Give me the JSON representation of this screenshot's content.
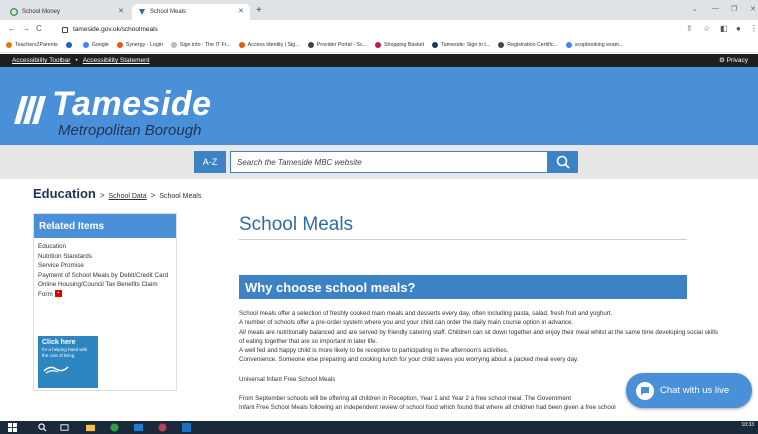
{
  "browser": {
    "tabs": [
      {
        "label": "School Money",
        "active": false
      },
      {
        "label": "School Meals",
        "active": true
      }
    ],
    "url": "tameside.gov.uk/schoolmeals",
    "bookmarks": [
      "Teachers2Parents",
      "Google",
      "Synergy - Login",
      "Sign into : The IT Fr...",
      "Access Identity | Sig...",
      "Provider Portal - Sc...",
      "Shopping Basket",
      "Tameside: Sign in t...",
      "Registration Certific...",
      "scopbooking exam..."
    ]
  },
  "accessibility": {
    "toolbar": "Accessibility Toolbar",
    "statement": "Accessibility Statement",
    "privacy": "Privacy"
  },
  "header": {
    "brand": "Tameside",
    "sub": "Metropolitan Borough"
  },
  "search": {
    "az": "A-Z",
    "placeholder": "Search the Tameside MBC website"
  },
  "breadcrumb": {
    "root": "Education",
    "item1": "School Data",
    "current": "School Meals"
  },
  "related": {
    "heading": "Related Items",
    "items": [
      "Education",
      "Nutrition Standards",
      "Service Promise",
      "Payment of School Meals by Debit/Credit Card",
      "Online Housing/Council Tax Benefits Claim Form"
    ],
    "promo_title": "Click here",
    "promo_text": "for a helping hand with the cost of living"
  },
  "content": {
    "title": "School Meals",
    "section": "Why choose school meals?",
    "paragraphs": [
      "School meals offer a selection of freshly cooked main meals and desserts every day, often including pasta, salad, fresh fruit and yoghurt.",
      "A number of schools offer a pre-order system where you and your child can order the daily main course option in advance.",
      "All meals are nutritionally balanced and are served by friendly catering staff. Children can sit down together and enjoy their meal whilst at the same time developing social skills of eating together that are so important in later life.",
      "A well fed and happy child is more likely to be receptive to participating in the afternoon's activities.",
      "Convenience. Someone else preparing and cooking lunch for your child saves you worrying about a packed meal every day."
    ],
    "subheading": "Universal Infant Free School Meals",
    "para2": "From September schools will be offering all children in Reception, Year 1 and Year 2 a free school meal. The Government",
    "para3": "Infant Free School Meals following an independent review of school food which found that where all children had been given a free school"
  },
  "chat": {
    "label": "Chat with us live"
  },
  "taskbar": {
    "time": "10:33"
  }
}
